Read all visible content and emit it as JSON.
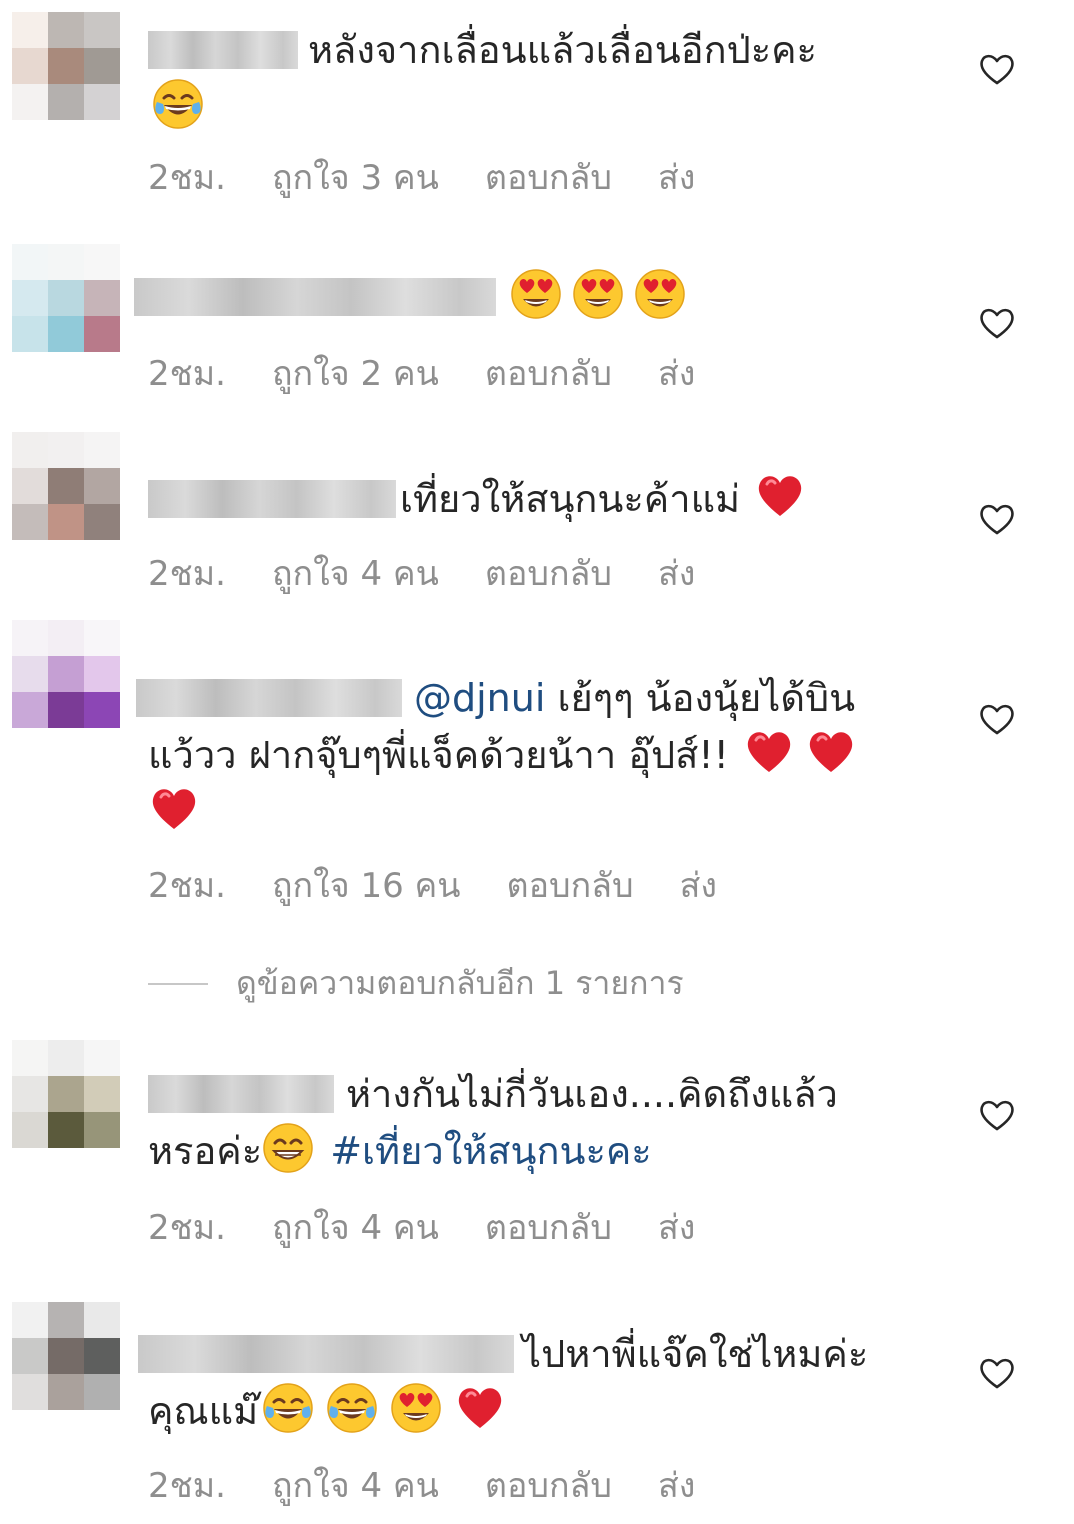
{
  "comments": [
    {
      "text": "หลังจากเลื่อนแล้วเลื่อนอีกป่ะคะ",
      "emojis": [
        "face-with-tears-of-joy"
      ],
      "time": "2ชม.",
      "likes": "ถูกใจ 3 คน",
      "reply": "ตอบกลับ",
      "send": "ส่ง"
    },
    {
      "text": "",
      "emojis": [
        "heart-eyes",
        "heart-eyes",
        "heart-eyes"
      ],
      "time": "2ชม.",
      "likes": "ถูกใจ 2 คน",
      "reply": "ตอบกลับ",
      "send": "ส่ง"
    },
    {
      "text": "เที่ยวให้สนุกนะค้าแม่",
      "emojis": [
        "red-heart"
      ],
      "time": "2ชม.",
      "likes": "ถูกใจ 4 คน",
      "reply": "ตอบกลับ",
      "send": "ส่ง"
    },
    {
      "mention": "@djnui",
      "text_line1": "เย้ๆๆ น้องนุ้ยได้บิน",
      "text_line2": "แว้วว ฝากจุ๊บๆพี่แจ็คด้วยน้าา อุ๊ปส์!!",
      "emojis": [
        "red-heart",
        "red-heart",
        "red-heart"
      ],
      "time": "2ชม.",
      "likes": "ถูกใจ 16 คน",
      "reply": "ตอบกลับ",
      "send": "ส่ง"
    },
    {
      "text_line1": "ห่างกันไม่กี่วันเอง....คิดถึงแล้ว",
      "text_line2": "หรอค่ะ",
      "hashtag": "#เที่ยวให้สนุกนะคะ",
      "emojis": [
        "grinning-face"
      ],
      "time": "2ชม.",
      "likes": "ถูกใจ 4 คน",
      "reply": "ตอบกลับ",
      "send": "ส่ง"
    },
    {
      "text_line1": "ไปหาพี่แจ๊คใช่ไหมค่ะ",
      "text_line2": "คุณแม๊",
      "emojis": [
        "face-with-tears-of-joy",
        "face-with-tears-of-joy",
        "heart-eyes",
        "red-heart"
      ],
      "time": "2ชม.",
      "likes": "ถูกใจ 4 คน",
      "reply": "ตอบกลับ",
      "send": "ส่ง"
    }
  ],
  "view_replies": "ดูข้อความตอบกลับอีก 1 รายการ",
  "colors": {
    "meta_text": "#8e8e8e",
    "link": "#1f4d80",
    "heart": "#e0202f"
  },
  "icons": [
    "like-heart-outline-icon"
  ]
}
